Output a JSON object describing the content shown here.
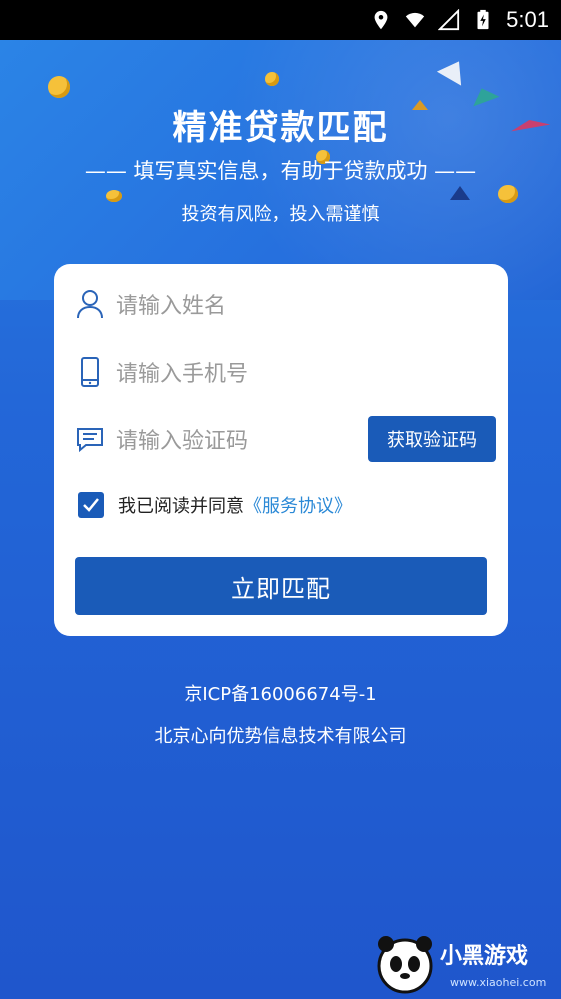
{
  "status_bar": {
    "time": "5:01"
  },
  "header": {
    "title": "精准贷款匹配",
    "subtitle": "—— 填写真实信息，有助于贷款成功 ——",
    "risk_notice": "投资有风险，投入需谨慎"
  },
  "form": {
    "name_placeholder": "请输入姓名",
    "phone_placeholder": "请输入手机号",
    "code_placeholder": "请输入验证码",
    "get_code_label": "获取验证码",
    "agree_text": "我已阅读并同意",
    "agreement_link": "《服务协议》",
    "agree_checked": true,
    "submit_label": "立即匹配"
  },
  "footer": {
    "icp": "京ICP备16006674号-1",
    "company": "北京心向优势信息技术有限公司"
  },
  "watermark": {
    "text": "小黑游戏",
    "url": "www.xiaohei.com"
  },
  "colors": {
    "primary": "#1a5bb8",
    "background": "#2367d8",
    "link": "#2b89d6",
    "placeholder": "#9a9a9a"
  },
  "icons": [
    "location-icon",
    "wifi-icon",
    "signal-icon",
    "battery-icon",
    "user-icon",
    "phone-icon",
    "message-icon",
    "check-icon"
  ]
}
